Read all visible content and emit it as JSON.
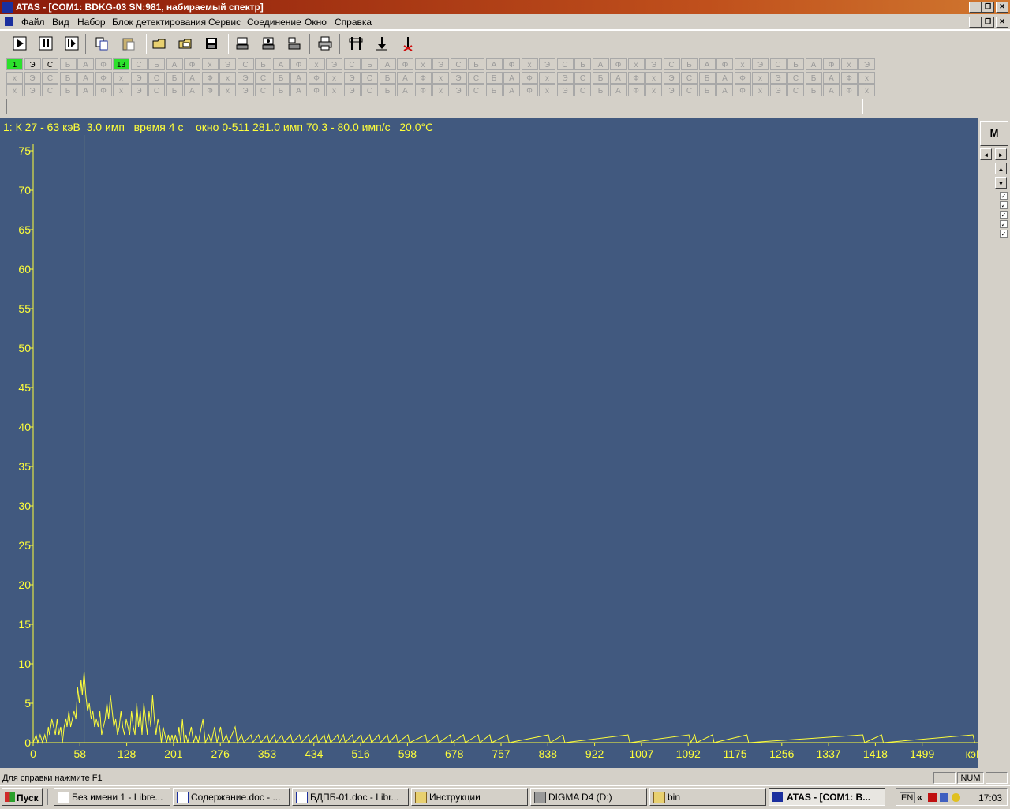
{
  "window": {
    "title": "ATAS  - [COM1: BDKG-03 SN:981, набираемый спектр]",
    "controls": [
      "_",
      "❐",
      "✕"
    ]
  },
  "menu": [
    "Файл",
    "Вид",
    "Набор",
    "Блок детектирования",
    "Сервис",
    "Соединение",
    "Окно",
    "Справка"
  ],
  "toolbar": {
    "buttons": [
      "play-icon",
      "pause-icon",
      "step-icon",
      "copy-icon",
      "paste-icon",
      "open-icon",
      "open-folder-icon",
      "save-icon",
      "detector-1-icon",
      "detector-2-icon",
      "detector-3-icon",
      "print-icon",
      "marker-pair-icon",
      "marker-down-icon",
      "marker-delete-icon"
    ]
  },
  "channel_grid": {
    "pattern": [
      "Э",
      "С",
      "Б",
      "А",
      "Ф",
      "х"
    ],
    "row1_first": [
      "1",
      "Э",
      "С",
      "Б",
      "А",
      "Ф",
      "13"
    ],
    "active_cells": [
      "1",
      "13"
    ],
    "active_color": "#2ce02c"
  },
  "status_line": "1: К 27 - 63 кэВ  3.0 имп   время 4 с    окно 0-511 281.0 имп 70.3 - 80.0 имп/с   20.0°С",
  "chart_data": {
    "type": "line",
    "x_unit": "кэВ",
    "x_ticks": [
      "0",
      "58",
      "128",
      "201",
      "276",
      "353",
      "434",
      "516",
      "598",
      "678",
      "757",
      "838",
      "922",
      "1007",
      "1092",
      "1175",
      "1256",
      "1337",
      "1418",
      "1499"
    ],
    "y_ticks": [
      "0",
      "5",
      "10",
      "15",
      "20",
      "25",
      "30",
      "35",
      "40",
      "45",
      "50",
      "55",
      "60",
      "65",
      "70",
      "75"
    ],
    "ylim": [
      0,
      77
    ],
    "xlim": [
      0,
      1640
    ],
    "background": "#41597f",
    "line_color": "#ffff3a",
    "marker_x": 87,
    "series": [
      {
        "values": [
          [
            0,
            0
          ],
          [
            5,
            1
          ],
          [
            8,
            0
          ],
          [
            12,
            1
          ],
          [
            16,
            0
          ],
          [
            20,
            1
          ],
          [
            23,
            0
          ],
          [
            26,
            2
          ],
          [
            28,
            1
          ],
          [
            32,
            3
          ],
          [
            35,
            2
          ],
          [
            38,
            1
          ],
          [
            41,
            3
          ],
          [
            44,
            1
          ],
          [
            47,
            2
          ],
          [
            50,
            0
          ],
          [
            53,
            2
          ],
          [
            56,
            3
          ],
          [
            58,
            2
          ],
          [
            61,
            4
          ],
          [
            64,
            2
          ],
          [
            67,
            3
          ],
          [
            70,
            4
          ],
          [
            73,
            3
          ],
          [
            76,
            7
          ],
          [
            79,
            5
          ],
          [
            82,
            8
          ],
          [
            84,
            6
          ],
          [
            87,
            9
          ],
          [
            90,
            6
          ],
          [
            93,
            4
          ],
          [
            96,
            5
          ],
          [
            99,
            3
          ],
          [
            102,
            4
          ],
          [
            105,
            2
          ],
          [
            108,
            3
          ],
          [
            111,
            2
          ],
          [
            114,
            4
          ],
          [
            117,
            1
          ],
          [
            120,
            2
          ],
          [
            123,
            3
          ],
          [
            126,
            5
          ],
          [
            129,
            3
          ],
          [
            132,
            6
          ],
          [
            135,
            4
          ],
          [
            138,
            2
          ],
          [
            141,
            3
          ],
          [
            144,
            1
          ],
          [
            147,
            2
          ],
          [
            150,
            4
          ],
          [
            153,
            2
          ],
          [
            156,
            1
          ],
          [
            159,
            3
          ],
          [
            162,
            2
          ],
          [
            165,
            1
          ],
          [
            168,
            4
          ],
          [
            171,
            2
          ],
          [
            174,
            1
          ],
          [
            177,
            5
          ],
          [
            180,
            2
          ],
          [
            183,
            4
          ],
          [
            186,
            1
          ],
          [
            189,
            5
          ],
          [
            192,
            3
          ],
          [
            195,
            1
          ],
          [
            198,
            4
          ],
          [
            201,
            2
          ],
          [
            204,
            6
          ],
          [
            207,
            3
          ],
          [
            210,
            1
          ],
          [
            213,
            3
          ],
          [
            216,
            2
          ],
          [
            219,
            0
          ],
          [
            222,
            2
          ],
          [
            225,
            1
          ],
          [
            228,
            0
          ],
          [
            231,
            1
          ],
          [
            234,
            0
          ],
          [
            237,
            1
          ],
          [
            240,
            0
          ],
          [
            243,
            1
          ],
          [
            246,
            0
          ],
          [
            249,
            2
          ],
          [
            252,
            0
          ],
          [
            255,
            3
          ],
          [
            258,
            0
          ],
          [
            261,
            1
          ],
          [
            264,
            0
          ],
          [
            270,
            2
          ],
          [
            274,
            0
          ],
          [
            278,
            1
          ],
          [
            282,
            0
          ],
          [
            290,
            3
          ],
          [
            294,
            0
          ],
          [
            300,
            1
          ],
          [
            304,
            0
          ],
          [
            310,
            2
          ],
          [
            314,
            0
          ],
          [
            320,
            2
          ],
          [
            324,
            0
          ],
          [
            330,
            1
          ],
          [
            334,
            0
          ],
          [
            345,
            2
          ],
          [
            349,
            0
          ],
          [
            356,
            1
          ],
          [
            360,
            0
          ],
          [
            372,
            1
          ],
          [
            375,
            0
          ],
          [
            385,
            1
          ],
          [
            389,
            0
          ],
          [
            400,
            1
          ],
          [
            403,
            0
          ],
          [
            412,
            1
          ],
          [
            415,
            0
          ],
          [
            425,
            1
          ],
          [
            429,
            0
          ],
          [
            440,
            1
          ],
          [
            443,
            0
          ],
          [
            455,
            1
          ],
          [
            458,
            0
          ],
          [
            470,
            1
          ],
          [
            473,
            0
          ],
          [
            484,
            1
          ],
          [
            487,
            0
          ],
          [
            497,
            1
          ],
          [
            500,
            0
          ],
          [
            505,
            1
          ],
          [
            508,
            0
          ],
          [
            520,
            1
          ],
          [
            523,
            0
          ],
          [
            530,
            1
          ],
          [
            533,
            0
          ],
          [
            545,
            1
          ],
          [
            548,
            0
          ],
          [
            560,
            1
          ],
          [
            563,
            0
          ],
          [
            575,
            1
          ],
          [
            578,
            0
          ],
          [
            590,
            1
          ],
          [
            593,
            0
          ],
          [
            605,
            1
          ],
          [
            608,
            0
          ],
          [
            620,
            1
          ],
          [
            623,
            0
          ],
          [
            640,
            1
          ],
          [
            643,
            0
          ],
          [
            670,
            1
          ],
          [
            673,
            0
          ],
          [
            690,
            1
          ],
          [
            693,
            0
          ],
          [
            712,
            1
          ],
          [
            715,
            0
          ],
          [
            735,
            1
          ],
          [
            738,
            0
          ],
          [
            760,
            1
          ],
          [
            763,
            0
          ],
          [
            780,
            1
          ],
          [
            783,
            0
          ],
          [
            810,
            1
          ],
          [
            813,
            0
          ],
          [
            880,
            1
          ],
          [
            883,
            0
          ],
          [
            905,
            1
          ],
          [
            908,
            0
          ],
          [
            1016,
            1
          ],
          [
            1019,
            0
          ],
          [
            1120,
            1
          ],
          [
            1123,
            0
          ],
          [
            1130,
            1
          ],
          [
            1133,
            0
          ],
          [
            1160,
            1
          ],
          [
            1163,
            0
          ],
          [
            1219,
            1
          ],
          [
            1222,
            0
          ],
          [
            1417,
            1
          ],
          [
            1420,
            0
          ],
          [
            1449,
            1
          ],
          [
            1452,
            0
          ],
          [
            1605,
            1
          ],
          [
            1608,
            0
          ],
          [
            1640,
            0
          ]
        ]
      }
    ]
  },
  "right_panel": {
    "m_button": "M",
    "checkbox_count": 6
  },
  "statusbar": {
    "help_text": "Для справки нажмите F1",
    "num_indicator": "NUM"
  },
  "taskbar": {
    "start_label": "Пуск",
    "tasks": [
      "Без имени 1 - Libre...",
      "Содержание.doc - ...",
      "БДПБ-01.doc - Libr...",
      "Инструкции",
      "DIGMA D4 (D:)",
      "bin",
      "ATAS  - [COM1: B..."
    ],
    "active_task_index": 6,
    "tray_lang": "EN",
    "clock": "17:03"
  }
}
